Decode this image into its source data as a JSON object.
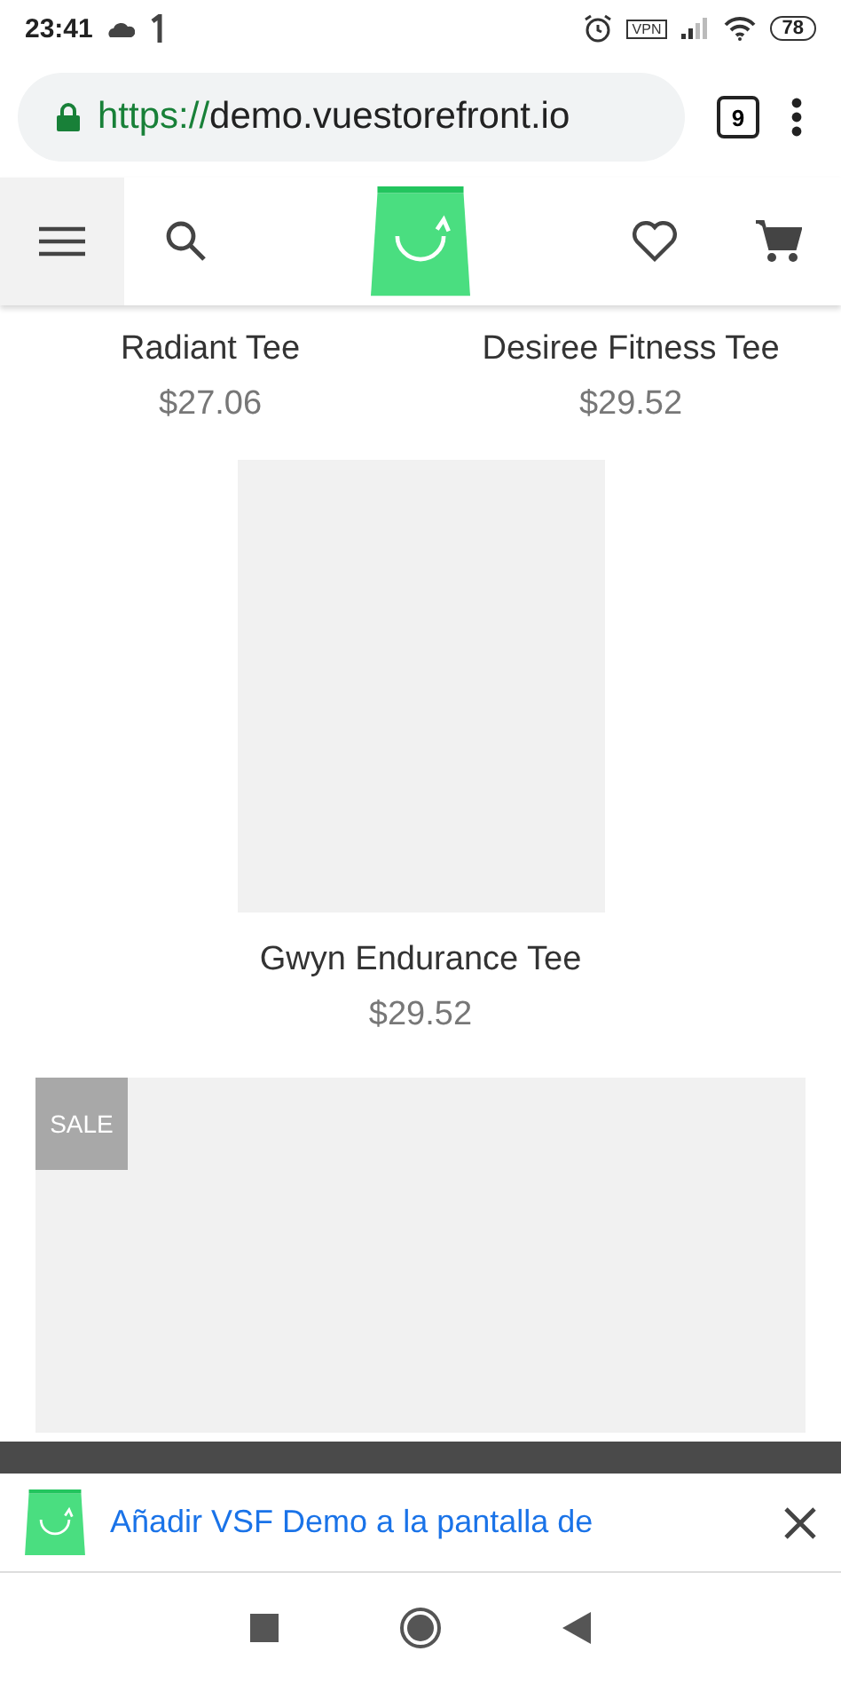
{
  "status_bar": {
    "time": "23:41",
    "vpn": "VPN",
    "battery": "78"
  },
  "browser": {
    "url_scheme": "https://",
    "url_host": "demo.vuestorefront.io",
    "tab_count": "9"
  },
  "products_row": [
    {
      "name": "Radiant Tee",
      "price": "$27.06"
    },
    {
      "name": "Desiree Fitness Tee",
      "price": "$29.52"
    }
  ],
  "product_single": {
    "name": "Gwyn Endurance Tee",
    "price": "$29.52"
  },
  "sale_card": {
    "badge": "SALE"
  },
  "install_banner": {
    "text": "Añadir VSF Demo a la pantalla de"
  }
}
